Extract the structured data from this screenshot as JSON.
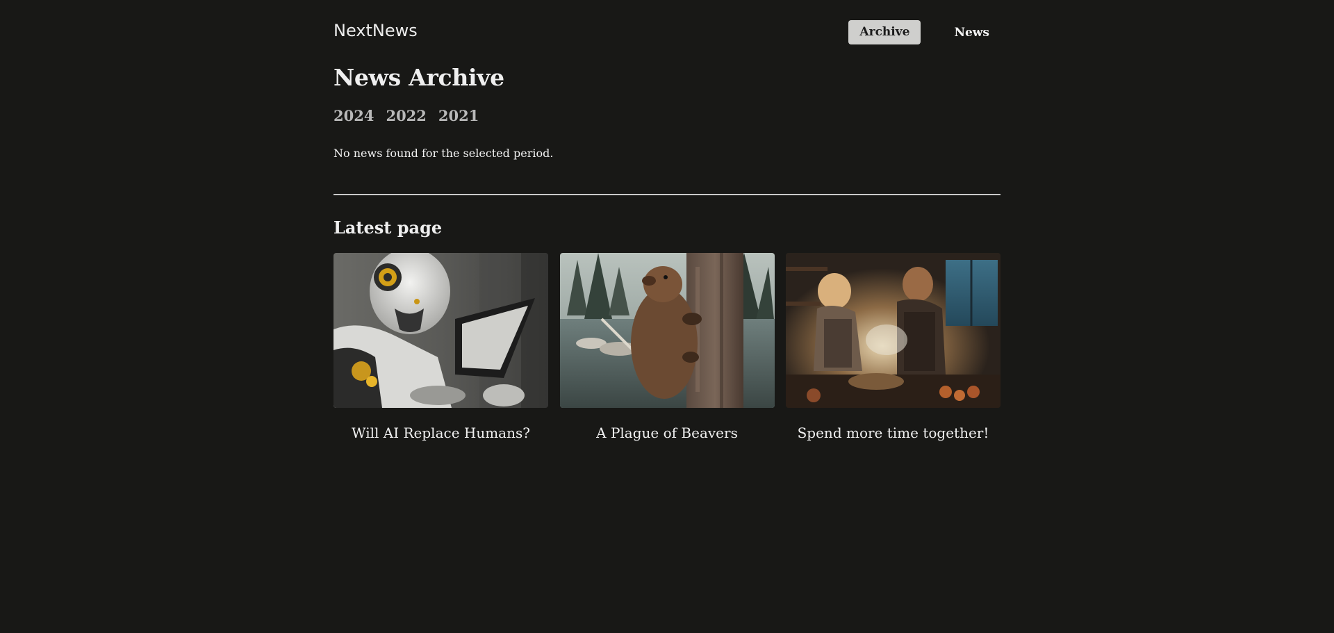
{
  "header": {
    "logo": "NextNews",
    "nav": {
      "archive_label": "Archive",
      "news_label": "News"
    }
  },
  "archive": {
    "title": "News Archive",
    "years": [
      "2024",
      "2022",
      "2021"
    ],
    "empty_message": "No news found for the selected period."
  },
  "latest": {
    "title": "Latest page",
    "cards": [
      {
        "title": "Will AI Replace Humans?",
        "image": "robot-with-tablet-image"
      },
      {
        "title": "A Plague of Beavers",
        "image": "beaver-on-tree-image"
      },
      {
        "title": "Spend more time together!",
        "image": "couple-cooking-image"
      }
    ]
  },
  "colors": {
    "background": "#181816",
    "text": "#ececec",
    "active_nav_bg": "#cfcfcd",
    "year_link": "#b9b9b9",
    "divider": "#c9c9c9"
  }
}
